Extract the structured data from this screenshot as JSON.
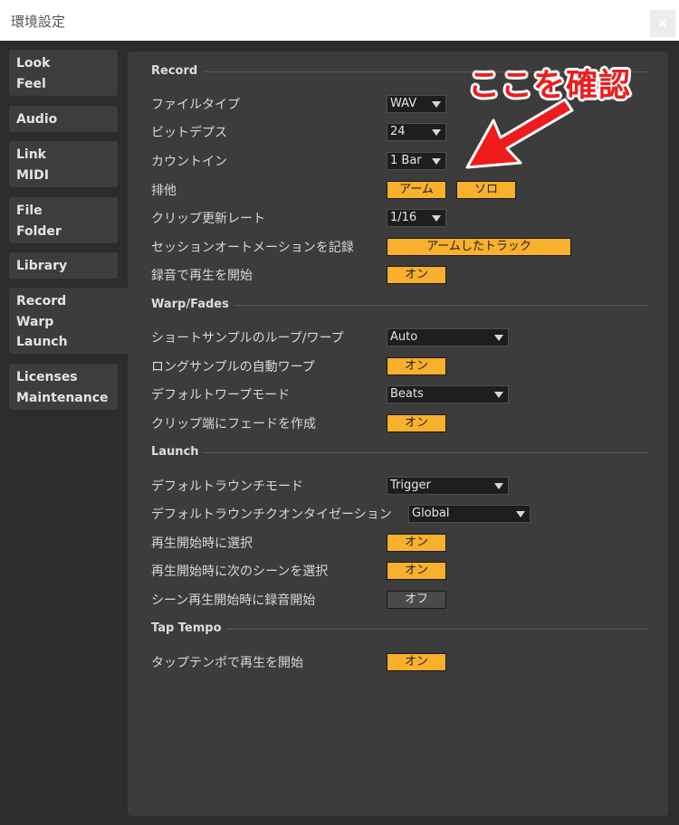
{
  "window": {
    "title": "環境設定",
    "close_label": "×"
  },
  "sidebar": {
    "items": [
      {
        "line1": "Look",
        "line2": "Feel"
      },
      {
        "line1": "Audio"
      },
      {
        "line1": "Link",
        "line2": "MIDI"
      },
      {
        "line1": "File",
        "line2": "Folder"
      },
      {
        "line1": "Library"
      },
      {
        "line1": "Record",
        "line2": "Warp",
        "line3": "Launch"
      },
      {
        "line1": "Licenses",
        "line2": "Maintenance"
      }
    ],
    "active_index": 5
  },
  "sections": {
    "record": {
      "title": "Record",
      "file_type": {
        "label": "ファイルタイプ",
        "value": "WAV"
      },
      "bit_depth": {
        "label": "ビットデプス",
        "value": "24"
      },
      "count_in": {
        "label": "カウントイン",
        "value": "1 Bar"
      },
      "exclusive": {
        "label": "排他",
        "arm": "アーム",
        "solo": "ソロ"
      },
      "clip_update_rate": {
        "label": "クリップ更新レート",
        "value": "1/16"
      },
      "session_automation": {
        "label": "セッションオートメーションを記録",
        "value": "アームしたトラック"
      },
      "start_playback_on_record": {
        "label": "録音で再生を開始",
        "value": "オン"
      }
    },
    "warp": {
      "title": "Warp/Fades",
      "short_sample_loop": {
        "label": "ショートサンプルのループ/ワープ",
        "value": "Auto"
      },
      "long_sample_autowarp": {
        "label": "ロングサンプルの自動ワープ",
        "value": "オン"
      },
      "default_warp_mode": {
        "label": "デフォルトワープモード",
        "value": "Beats"
      },
      "create_fades": {
        "label": "クリップ端にフェードを作成",
        "value": "オン"
      }
    },
    "launch": {
      "title": "Launch",
      "default_launch_mode": {
        "label": "デフォルトラウンチモード",
        "value": "Trigger"
      },
      "default_launch_quantization": {
        "label": "デフォルトラウンチクオンタイゼーション",
        "value": "Global"
      },
      "select_on_launch": {
        "label": "再生開始時に選択",
        "value": "オン"
      },
      "select_next_scene": {
        "label": "再生開始時に次のシーンを選択",
        "value": "オン"
      },
      "start_recording_on_scene": {
        "label": "シーン再生開始時に録音開始",
        "value": "オフ"
      }
    },
    "tap_tempo": {
      "title": "Tap Tempo",
      "start_playback": {
        "label": "タップテンポで再生を開始",
        "value": "オン"
      }
    }
  },
  "annotation": {
    "text": "ここを確認",
    "color": "#ee1c1c"
  },
  "colors": {
    "toggle_on": "#f8b02d",
    "background": "#2c2c2c",
    "panel": "#3c3c3c"
  }
}
